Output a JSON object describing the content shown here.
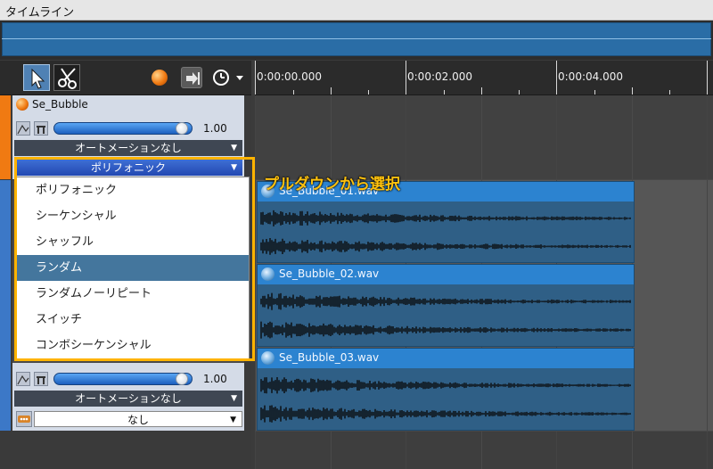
{
  "window": {
    "title": "タイムライン"
  },
  "toolbar": {
    "tools": [
      "select-tool",
      "cut-tool",
      "record-button",
      "step-button",
      "clock-menu"
    ]
  },
  "ruler": {
    "labels": [
      "0:00:00.000",
      "0:00:02.000",
      "0:00:04.000"
    ]
  },
  "tracks": [
    {
      "name": "Se_Bubble",
      "volume": "1.00",
      "volume_fraction": 0.93,
      "automation": "オートメーションなし",
      "mode": "ポリフォニック",
      "color": "#f07a12"
    },
    {
      "name": "",
      "volume": "1.00",
      "volume_fraction": 0.93,
      "automation": "オートメーションなし",
      "selector": "なし",
      "color": "#3c78c7"
    }
  ],
  "dropdown": {
    "items": [
      "ポリフォニック",
      "シーケンシャル",
      "シャッフル",
      "ランダム",
      "ランダムノーリピート",
      "スイッチ",
      "コンボシーケンシャル"
    ],
    "highlighted": "ランダム"
  },
  "clips": [
    "Se_Bubble_01.wav",
    "Se_Bubble_02.wav",
    "Se_Bubble_03.wav"
  ],
  "annotation": "プルダウンから選択",
  "colors": {
    "accent": "#ffb300",
    "clip_header": "#2c83d0",
    "highlight": "#44769d"
  }
}
